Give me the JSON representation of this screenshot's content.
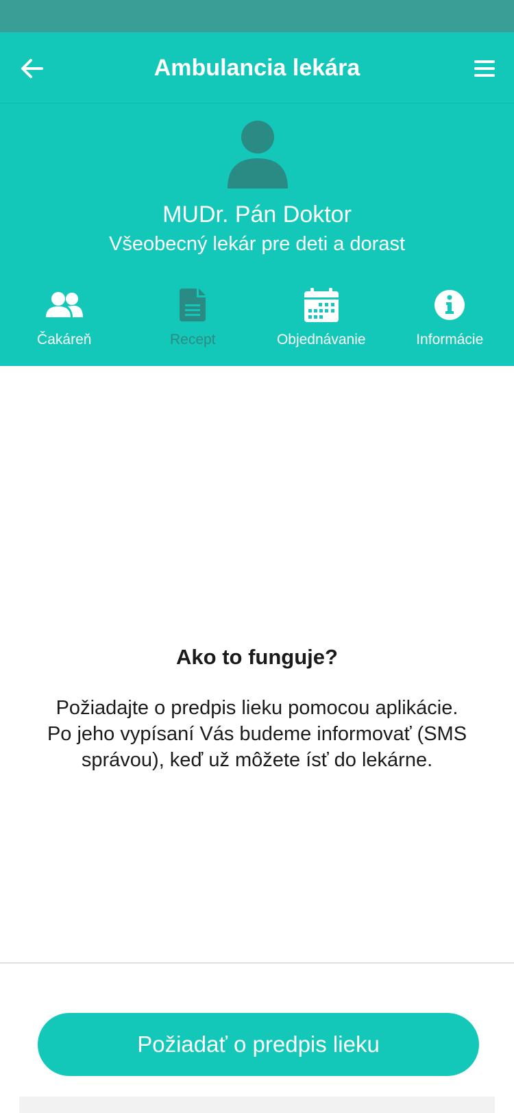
{
  "app_bar": {
    "title": "Ambulancia lekára",
    "back_icon": "arrow-left-icon",
    "menu_icon": "hamburger-menu-icon"
  },
  "profile": {
    "avatar_icon": "person-icon",
    "name": "MUDr. Pán Doktor",
    "specialty": "Všeobecný lekár pre deti a dorast"
  },
  "tabs": [
    {
      "label": "Čakáreň",
      "icon": "people-icon",
      "active": false
    },
    {
      "label": "Recept",
      "icon": "document-icon",
      "active": true
    },
    {
      "label": "Objednávanie",
      "icon": "calendar-icon",
      "active": false
    },
    {
      "label": "Informácie",
      "icon": "info-icon",
      "active": false
    }
  ],
  "content": {
    "title": "Ako to funguje?",
    "text": "Požiadajte o predpis lieku pomocou aplikácie. Po jeho vypísaní Vás budeme informovať (SMS správou), keď už môžete ísť do lekárne."
  },
  "cta": {
    "label": "Požiadať o predpis lieku"
  },
  "colors": {
    "primary": "#14c8b9",
    "status_bar": "#3a9e96",
    "active_tab": "#2f8a84",
    "avatar": "#2a8a84"
  }
}
